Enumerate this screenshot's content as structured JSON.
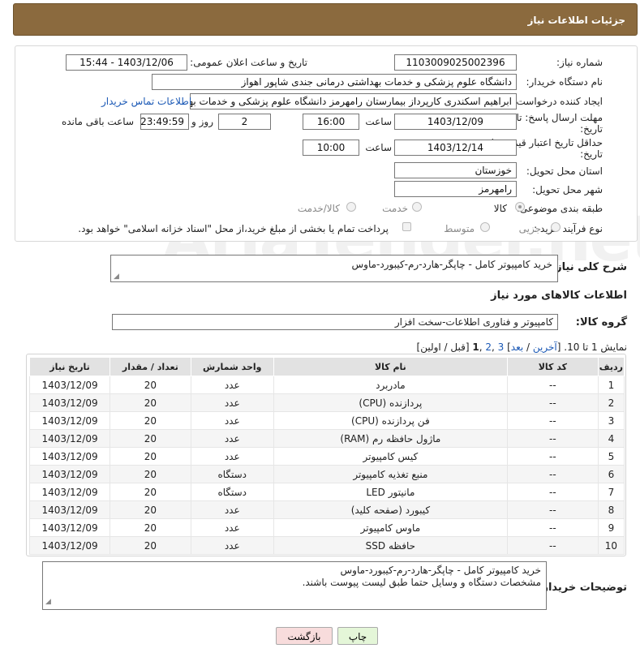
{
  "header": {
    "title": "جزئیات اطلاعات نیاز"
  },
  "form": {
    "need_number_label": "شماره نیاز:",
    "need_number": "1103009025002396",
    "announce_label": "تاریخ و ساعت اعلان عمومی:",
    "announce_value": "1403/12/06 - 15:44",
    "buyer_org_label": "نام دستگاه خریدار:",
    "buyer_org": "دانشگاه علوم پزشکی و خدمات بهداشتی درمانی جندی شاپور اهواز",
    "creator_label": "ایجاد کننده درخواست:",
    "creator": "ابراهیم اسکندری کارپرداز بیمارستان رامهرمز دانشگاه علوم پزشکی و خدمات بهد",
    "contact_link": "اطلاعات تماس خریدار",
    "deadline_label_1": "مهلت ارسال پاسخ: تا",
    "deadline_label_2": "تاریخ:",
    "deadline_date": "1403/12/09",
    "time_label": "ساعت",
    "deadline_time": "16:00",
    "days_value": "2",
    "days_label": "روز و",
    "remaining_value": "23:49:59",
    "remaining_label": "ساعت باقی مانده",
    "validity_label_1": "حداقل تاریخ اعتبار قیمت: تا",
    "validity_label_2": "تاریخ:",
    "validity_date": "1403/12/14",
    "validity_time": "10:00",
    "province_label": "استان محل تحویل:",
    "province": "خوزستان",
    "city_label": "شهر محل تحویل:",
    "city": "رامهرمز",
    "category_label": "طبقه بندی موضوعی:",
    "cat_goods": "کالا",
    "cat_service": "خدمت",
    "cat_goods_service": "کالا/خدمت",
    "process_label": "نوع فرآیند خرید :",
    "proc_partial": "جزیی",
    "proc_medium": "متوسط",
    "payment_note": "پرداخت تمام یا بخشی از مبلغ خرید،از محل \"اسناد خزانه اسلامی\" خواهد بود."
  },
  "description": {
    "label": "شرح کلی نیاز:",
    "value": "خرید کامپیوتر کامل - چاپگر-هارد-رم-کیبورد-ماوس"
  },
  "goods_section_title": "اطلاعات کالاهای مورد نیاز",
  "goods_group": {
    "label": "گروه کالا:",
    "value": "کامپیوتر و فناوری اطلاعات-سخت افزار"
  },
  "pager": {
    "prefix": "نمایش 1 تا 10. [",
    "last": "آخرین",
    "sep1": " / ",
    "next": "بعد",
    "sep2": "] ",
    "page3": "3",
    "comma1": " ,",
    "page2": "2",
    "comma2": " ,",
    "page1": "1",
    "suffix": " [قبل / اولین]"
  },
  "table": {
    "headers": [
      "ردیف",
      "کد کالا",
      "نام کالا",
      "واحد شمارش",
      "تعداد / مقدار",
      "تاریخ نیاز"
    ],
    "rows": [
      [
        "1",
        "--",
        "مادربرد",
        "عدد",
        "20",
        "1403/12/09"
      ],
      [
        "2",
        "--",
        "پردازنده (CPU)",
        "عدد",
        "20",
        "1403/12/09"
      ],
      [
        "3",
        "--",
        "فن پردازنده (CPU)",
        "عدد",
        "20",
        "1403/12/09"
      ],
      [
        "4",
        "--",
        "ماژول حافظه رم (RAM)",
        "عدد",
        "20",
        "1403/12/09"
      ],
      [
        "5",
        "--",
        "کیس کامپیوتر",
        "عدد",
        "20",
        "1403/12/09"
      ],
      [
        "6",
        "--",
        "منبع تغذیه کامپیوتر",
        "دستگاه",
        "20",
        "1403/12/09"
      ],
      [
        "7",
        "--",
        "مانیتور LED",
        "دستگاه",
        "20",
        "1403/12/09"
      ],
      [
        "8",
        "--",
        "کیبورد (صفحه کلید)",
        "عدد",
        "20",
        "1403/12/09"
      ],
      [
        "9",
        "--",
        "ماوس کامپیوتر",
        "عدد",
        "20",
        "1403/12/09"
      ],
      [
        "10",
        "--",
        "حافظه SSD",
        "عدد",
        "20",
        "1403/12/09"
      ]
    ]
  },
  "notes": {
    "label": "توضیحات خریدار:",
    "line1": "خرید کامپیوتر کامل - چاپگر-هارد-رم-کیبورد-ماوس",
    "line2": "مشخصات  دستگاه و  وسایل حتما طبق لیست پیوست باشند."
  },
  "buttons": {
    "print": "چاپ",
    "back": "بازگشت"
  },
  "watermark": "AriaTender.net"
}
